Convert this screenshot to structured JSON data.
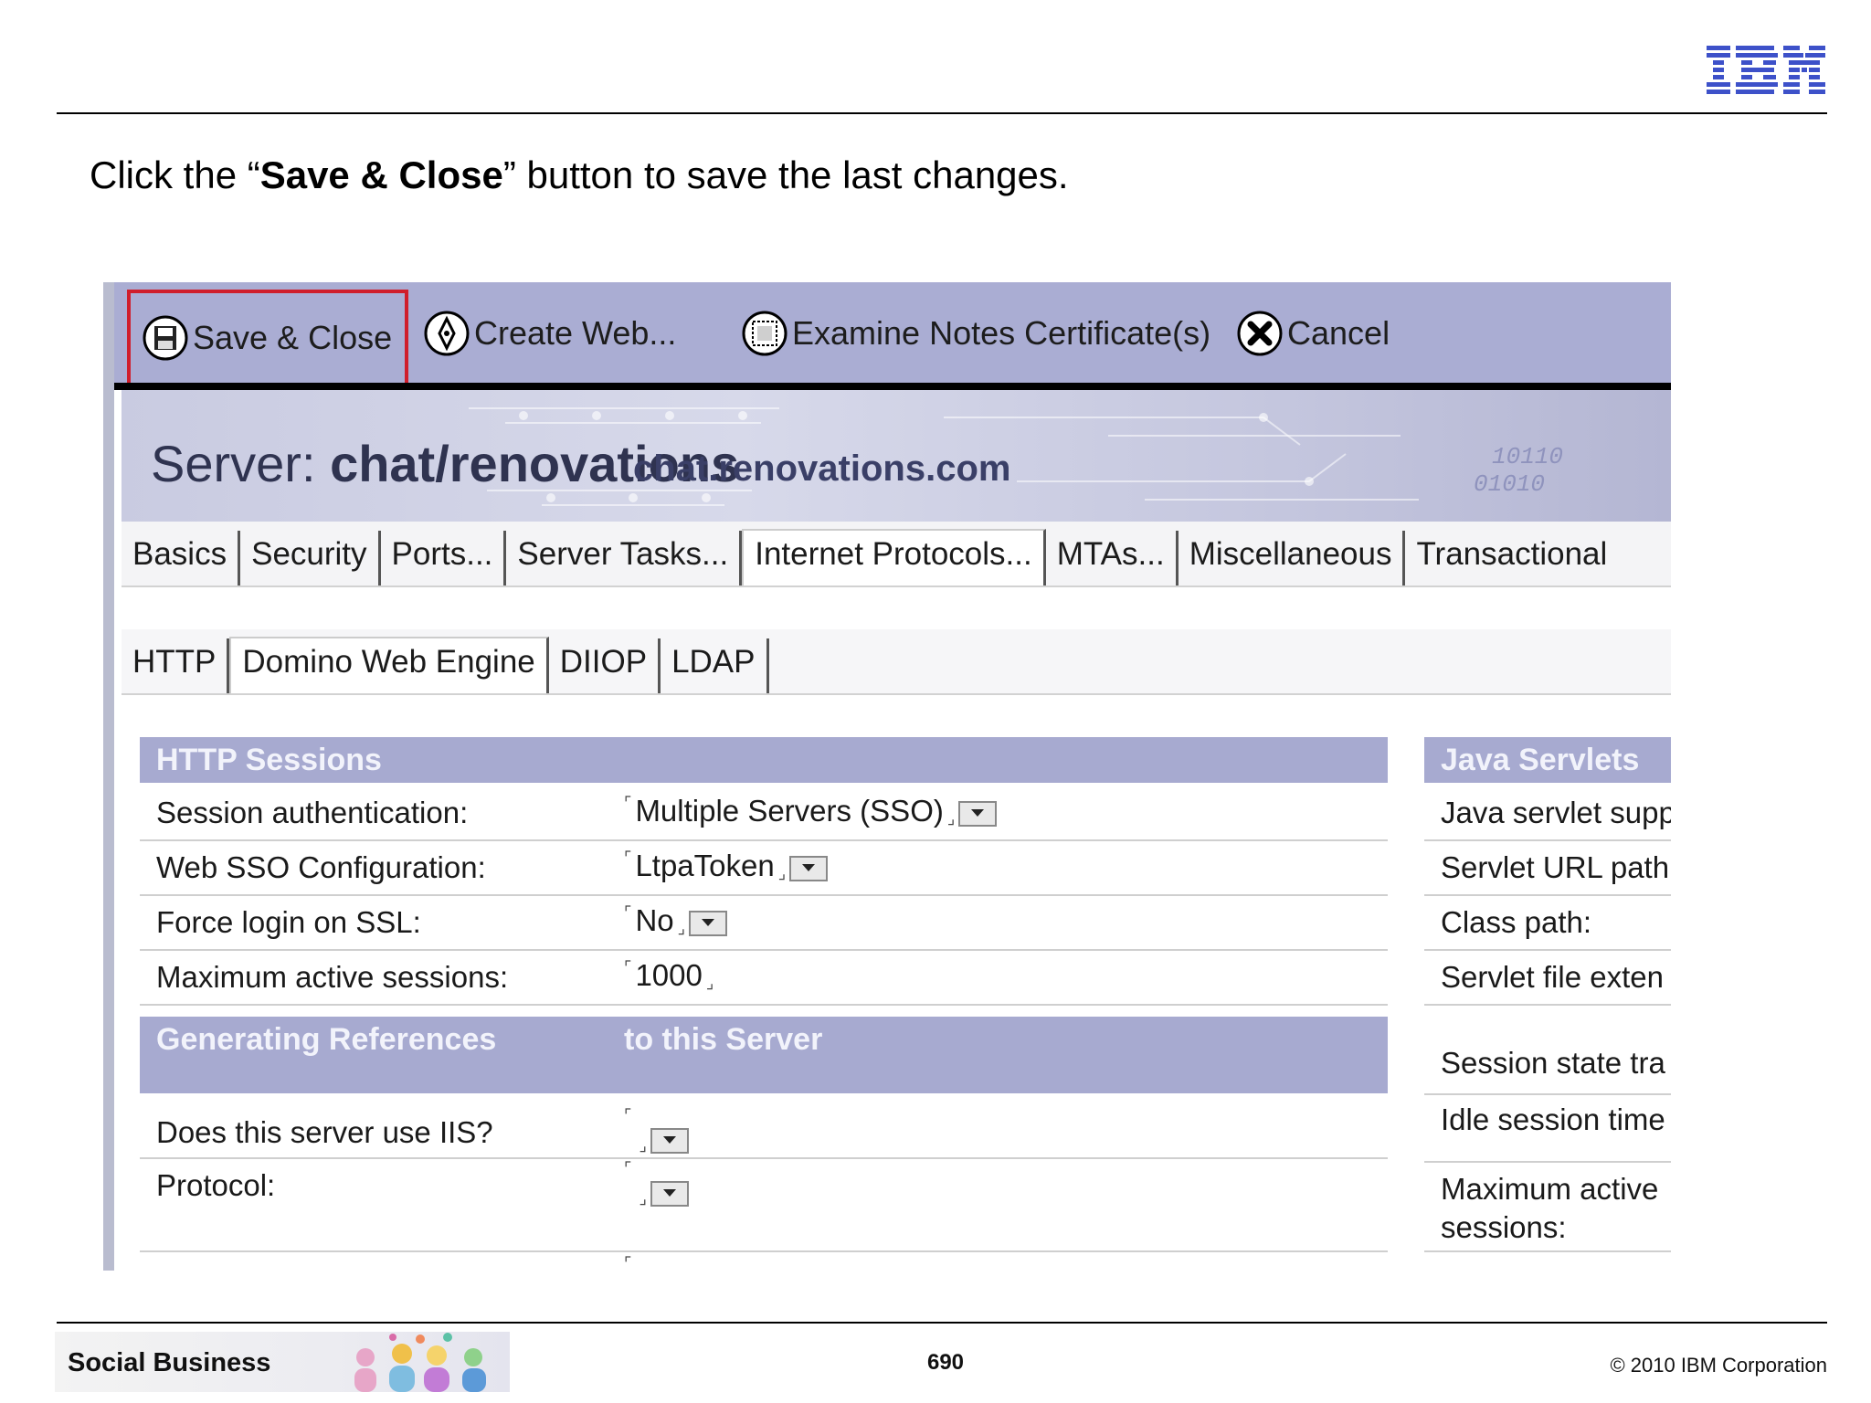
{
  "slide": {
    "logo_text": "IBM",
    "instruction": {
      "prefix": "Click the “",
      "bold": "Save & Close",
      "suffix": "” button to save the last changes."
    },
    "footer": {
      "brand": "Social Business",
      "page_number": "690",
      "copyright": "© 2010 IBM Corporation"
    }
  },
  "toolbar": {
    "save_close": "Save & Close",
    "create_web": "Create Web...",
    "examine_notes": "Examine Notes Certificate(s)",
    "cancel": "Cancel",
    "highlight_color": "#d01e2c"
  },
  "banner": {
    "label": "Server:",
    "server_name": "chat/renovations",
    "host": "chat.renovations.com"
  },
  "tabs_primary": [
    "Basics",
    "Security",
    "Ports...",
    "Server Tasks...",
    "Internet Protocols...",
    "MTAs...",
    "Miscellaneous",
    "Transactional"
  ],
  "tabs_secondary": [
    "HTTP",
    "Domino Web Engine",
    "DIIOP",
    "LDAP"
  ],
  "sections": {
    "http_sessions": {
      "title": "HTTP Sessions",
      "rows": [
        {
          "label": "Session authentication:",
          "value": "Multiple Servers (SSO)"
        },
        {
          "label": "Web SSO Configuration:",
          "value": "LtpaToken"
        },
        {
          "label": "Force login on SSL:",
          "value": "No"
        },
        {
          "label": "Maximum active sessions:",
          "value": "1000"
        }
      ]
    },
    "generating_refs": {
      "title_left": "Generating References",
      "title_right": "to this Server",
      "rows": [
        {
          "label": "Does this server use IIS?",
          "value": ""
        },
        {
          "label": "Protocol:",
          "value": ""
        }
      ]
    },
    "java_servlets": {
      "title": "Java Servlets",
      "rows": [
        "Java servlet supp",
        "Servlet URL path",
        "Class path:",
        "Servlet file exten",
        "Session state tra",
        "Idle session time",
        "Maximum active",
        "sessions:"
      ]
    }
  },
  "colors": {
    "toolbar": "#aaadd3",
    "section_header": "#a7aad0",
    "ibm_blue": "#4a5bd4"
  }
}
